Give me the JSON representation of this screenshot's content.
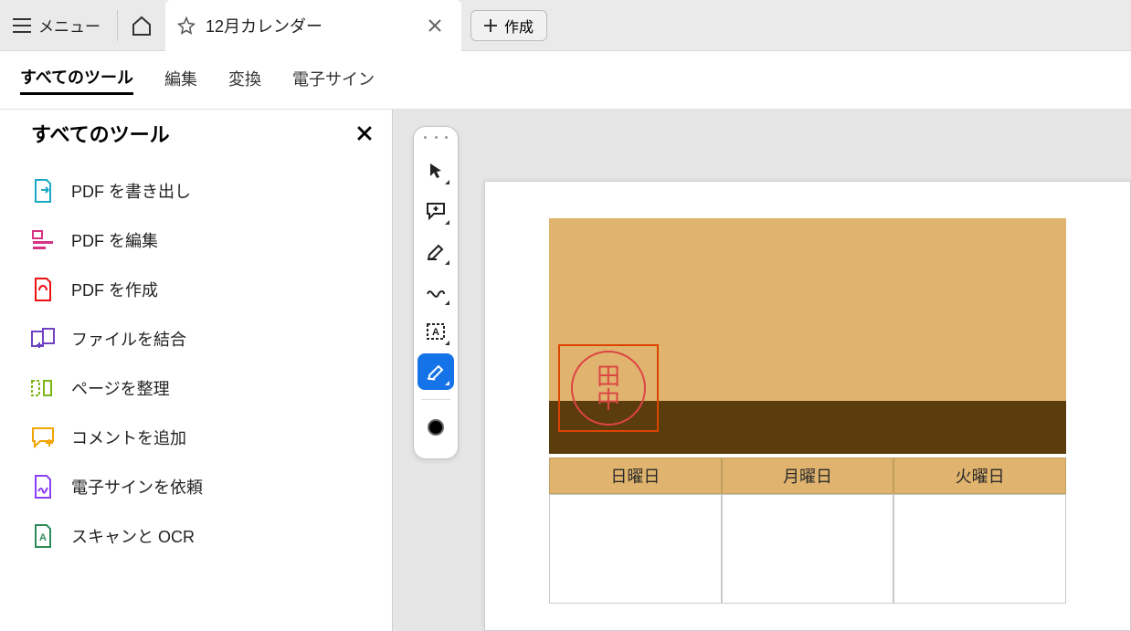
{
  "appbar": {
    "menu_label": "メニュー",
    "tab_title": "12月カレンダー",
    "create_label": "作成"
  },
  "menu": {
    "items": [
      "すべてのツール",
      "編集",
      "変換",
      "電子サイン"
    ],
    "active_index": 0
  },
  "tools_panel": {
    "title": "すべてのツール",
    "items": [
      {
        "name": "export-pdf",
        "label": "PDF を書き出し",
        "color": "#1aa8c4"
      },
      {
        "name": "edit-pdf",
        "label": "PDF を編集",
        "color": "#d63384"
      },
      {
        "name": "create-pdf",
        "label": "PDF を作成",
        "color": "#e11"
      },
      {
        "name": "combine-files",
        "label": "ファイルを結合",
        "color": "#6f42c1"
      },
      {
        "name": "organize-pages",
        "label": "ページを整理",
        "color": "#7cb518"
      },
      {
        "name": "add-comment",
        "label": "コメントを追加",
        "color": "#f0a500"
      },
      {
        "name": "request-esign",
        "label": "電子サインを依頼",
        "color": "#8a3ffc"
      },
      {
        "name": "scan-ocr",
        "label": "スキャンと OCR",
        "color": "#2e8b57"
      }
    ]
  },
  "vtoolbar": {
    "items": [
      {
        "name": "select-tool",
        "active": false
      },
      {
        "name": "comment-tool",
        "active": false
      },
      {
        "name": "highlight-tool",
        "active": false
      },
      {
        "name": "draw-tool",
        "active": false
      },
      {
        "name": "textbox-tool",
        "active": false
      },
      {
        "name": "sign-tool",
        "active": true
      }
    ],
    "color": "#000000"
  },
  "document": {
    "stamp_text_1": "田",
    "stamp_text_2": "中",
    "day_headers": [
      "日曜日",
      "月曜日",
      "火曜日"
    ]
  }
}
